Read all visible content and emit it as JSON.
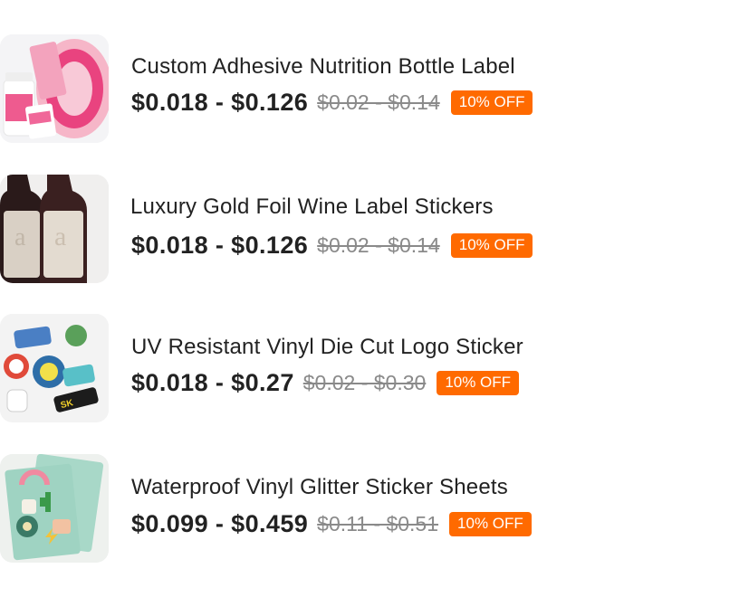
{
  "products": [
    {
      "title": "Custom Adhesive Nutrition Bottle Label",
      "price": "$0.018 - $0.126",
      "old_price": "$0.02 - $0.14",
      "discount": "10% OFF",
      "image_icon": "pink-bottle-label-rolls-image"
    },
    {
      "title": "Luxury Gold Foil Wine Label Stickers",
      "price": "$0.018 - $0.126",
      "old_price": "$0.02 - $0.14",
      "discount": "10% OFF",
      "image_icon": "wine-bottles-image"
    },
    {
      "title": "UV Resistant Vinyl Die Cut Logo Sticker",
      "price": "$0.018 - $0.27",
      "old_price": "$0.02 - $0.30",
      "discount": "10% OFF",
      "image_icon": "die-cut-stickers-image"
    },
    {
      "title": "Waterproof Vinyl Glitter Sticker Sheets",
      "price": "$0.099 - $0.459",
      "old_price": "$0.11 - $0.51",
      "discount": "10% OFF",
      "image_icon": "sticker-sheets-image"
    }
  ],
  "colors": {
    "discount_badge": "#ff6a00",
    "old_price": "#8a8a8a",
    "text": "#222222"
  }
}
